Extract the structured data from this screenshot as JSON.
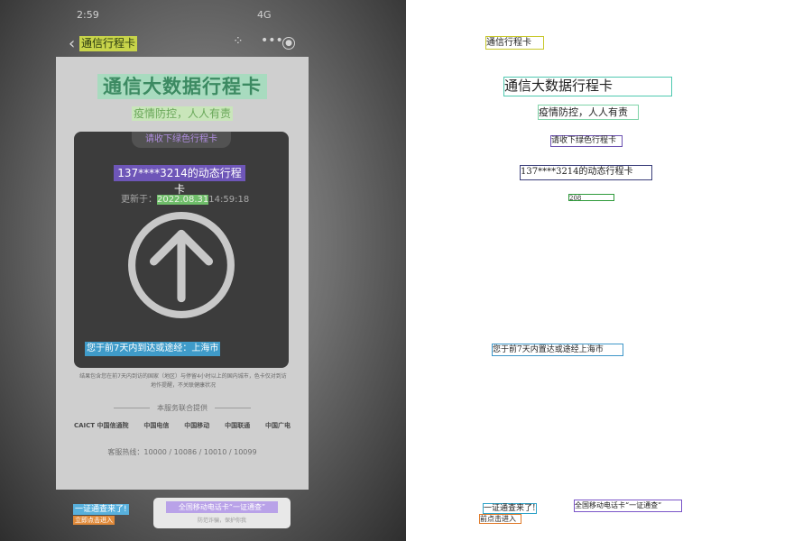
{
  "status_bar": {
    "time": "2:59",
    "right": "4G"
  },
  "nav": {
    "back_icon": "back-chevron-icon",
    "title": "通信行程卡",
    "grid_icon": "mini-program-icon",
    "more_icon": "more-dots-icon",
    "close_icon": "close-circle-icon"
  },
  "poster": {
    "title": "通信大数据行程卡",
    "subtitle": "疫情防控，人人有责",
    "card_tab": "请收下绿色行程卡",
    "phone_line": "137****3214的动态行程卡",
    "update_label": "更新于：",
    "update_date": "2022.08.31",
    "update_time": "14:59:18",
    "arrow_icon": "green-arrow-up-icon",
    "city_line": "您于前7天内到达或途经：上海市",
    "description": "结果包含您在前7天内到访的国家（地区）与停留4小时以上的国内城市，色卡仅对到访地作提醒，不关联健康状况",
    "provided_by": "本服务联合提供",
    "logos": [
      "CAICT 中国信通院",
      "中国电信",
      "中国移动",
      "中国联通",
      "中国广电"
    ],
    "hotline": "客服热线：10000 / 10086 / 10010 / 10099"
  },
  "bottom": {
    "banner_title": "一证通查来了!",
    "banner_sub": "立即点击进入",
    "promo_main": "全国移动电话卡“一证通查”",
    "promo_sub": "防范诈骗，保护你我"
  },
  "annotations": {
    "nav_title": "通信行程卡",
    "poster_title": "通信大数据行程卡",
    "subtitle": "疫情防控，人人有责",
    "card_tab": "请收下绿色行程卡",
    "phone_line": "137****3214的动态行程卡",
    "date_fragment": "208",
    "city_line": "您于前7天内置达或途经上海市",
    "banner_title": "一证通查来了!",
    "banner_sub": "前点击进入",
    "promo_main": "全国移动电话卡“一证通查”"
  },
  "colors": {
    "nav_title": "#c8c82a",
    "poster_title": "#4fc9b0",
    "subtitle": "#7fd3a8",
    "card_tab": "#6a4fb0",
    "phone_line": "#3a3f7a",
    "date_fragment": "#2e9a3a",
    "city_line": "#3d96c8",
    "banner_title": "#2fa3c8",
    "banner_sub": "#e07a2a",
    "promo_main": "#7a55c8"
  }
}
